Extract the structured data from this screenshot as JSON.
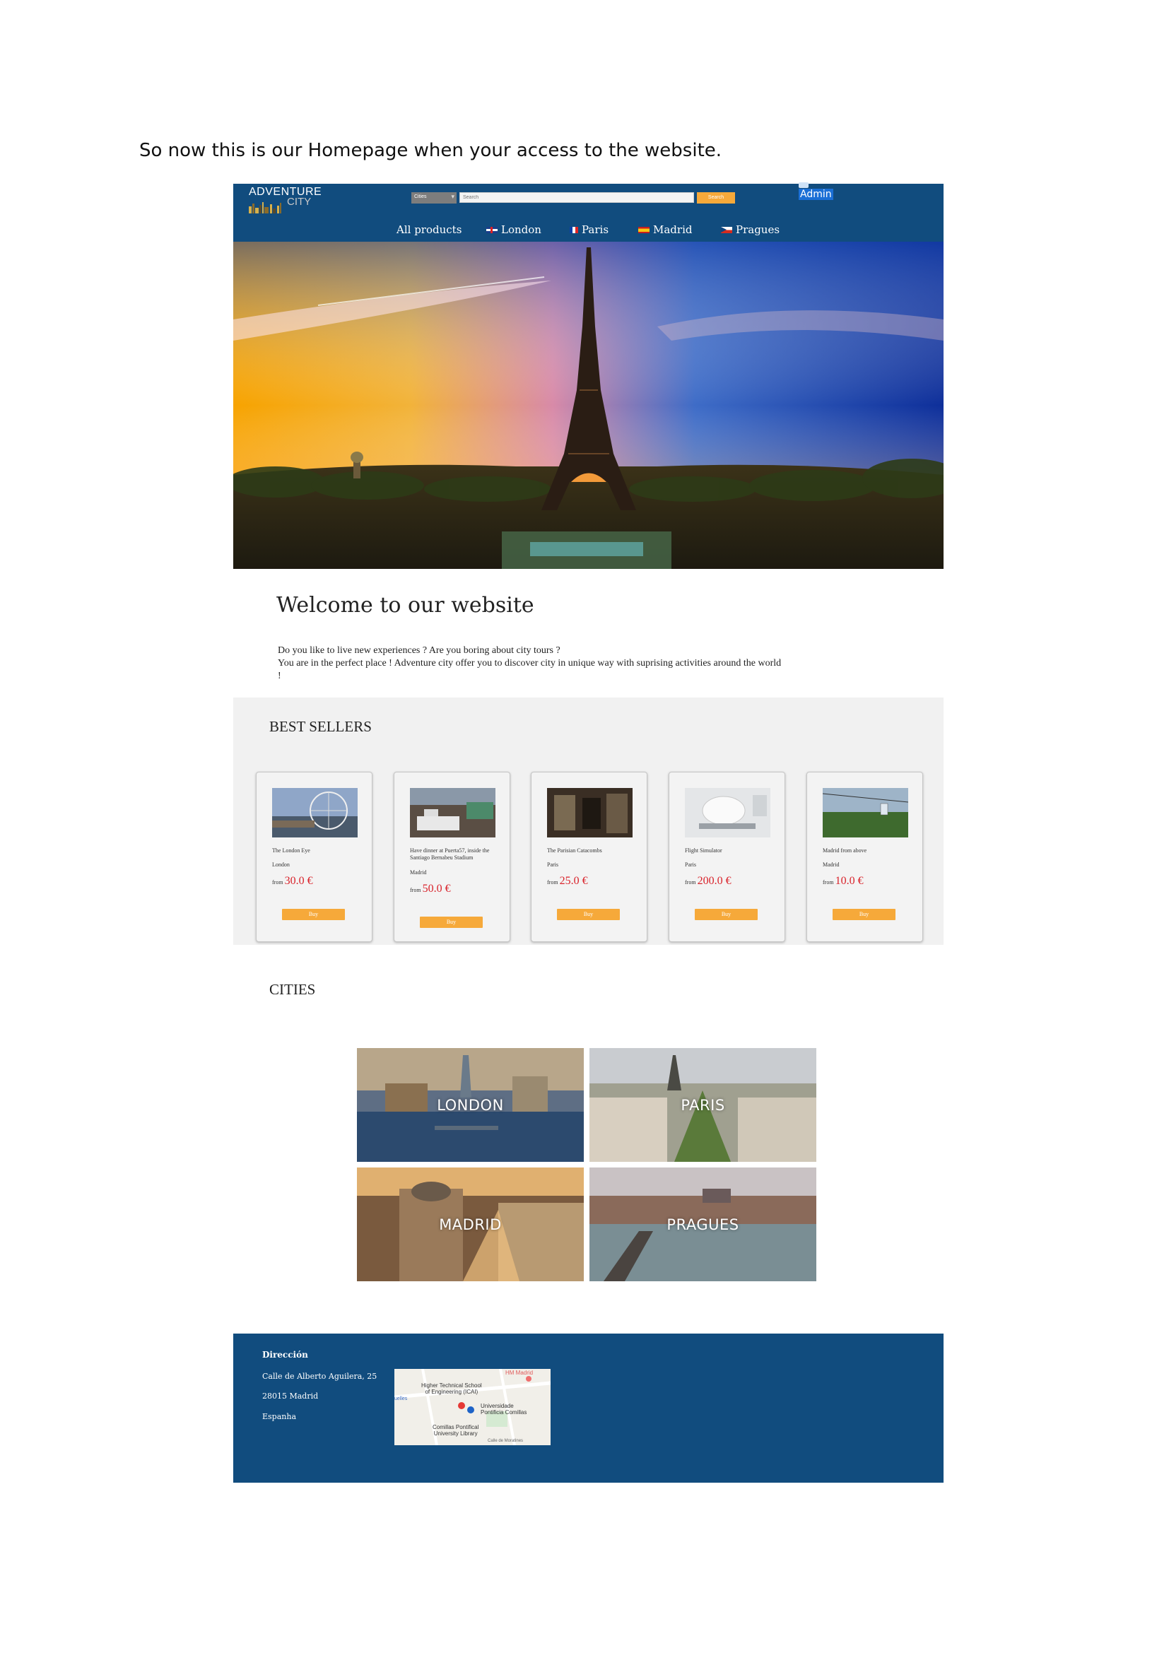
{
  "caption": "So now this is our Homepage when your access to the website.",
  "header": {
    "logo_line1": "ADVENTURE",
    "logo_line2": "CITY",
    "select_value": "Cities",
    "search_placeholder": "Search",
    "search_button": "Search",
    "admin_label": "Admin"
  },
  "nav": {
    "items": [
      {
        "label": "All products",
        "flag": ""
      },
      {
        "label": "London",
        "flag": "uk"
      },
      {
        "label": "Paris",
        "flag": "fr"
      },
      {
        "label": "Madrid",
        "flag": "es"
      },
      {
        "label": "Pragues",
        "flag": "cz"
      }
    ]
  },
  "welcome": {
    "title": "Welcome to our website",
    "line1": "Do you like to live new experiences ? Are you boring about city tours ?",
    "line2": "You are in the perfect place ! Adventure city offer you to discover city in unique way with suprising activities around the world !"
  },
  "best_sellers": {
    "title": "BEST SELLERS",
    "from_label": "from",
    "buy_label": "Buy",
    "products": [
      {
        "name": "The London Eye",
        "city": "London",
        "price": "30.0 €"
      },
      {
        "name": "Have dinner at Puerta57, inside the Santiago Bernabeu Stadium",
        "city": "Madrid",
        "price": "50.0 €"
      },
      {
        "name": "The Parisian Catacombs",
        "city": "Paris",
        "price": "25.0 €"
      },
      {
        "name": "Flight Simulator",
        "city": "Paris",
        "price": "200.0 €"
      },
      {
        "name": "Madrid from above",
        "city": "Madrid",
        "price": "10.0 €"
      }
    ]
  },
  "cities": {
    "title": "CITIES",
    "items": [
      "LONDON",
      "PARIS",
      "MADRID",
      "PRAGUES"
    ]
  },
  "footer": {
    "heading": "Dirección",
    "address_line1": "Calle de Alberto Aguilera, 25",
    "address_line2": "28015 Madrid",
    "address_line3": "Espanha",
    "map_labels": {
      "hm": "HM Madrid",
      "school": "Higher Technical School",
      "school2": "of Engineering (ICAI)",
      "uni": "Universidade",
      "uni2": "Pontificia Comillas",
      "lib": "Comillas Pontifical",
      "lib2": "University Library",
      "left": "uelles",
      "street": "Calle de Moratines"
    }
  },
  "colors": {
    "header_bg": "#114c7e",
    "accent_orange": "#f6a93a",
    "price_red": "#d9222a",
    "section_gray": "#f1f1f1"
  }
}
